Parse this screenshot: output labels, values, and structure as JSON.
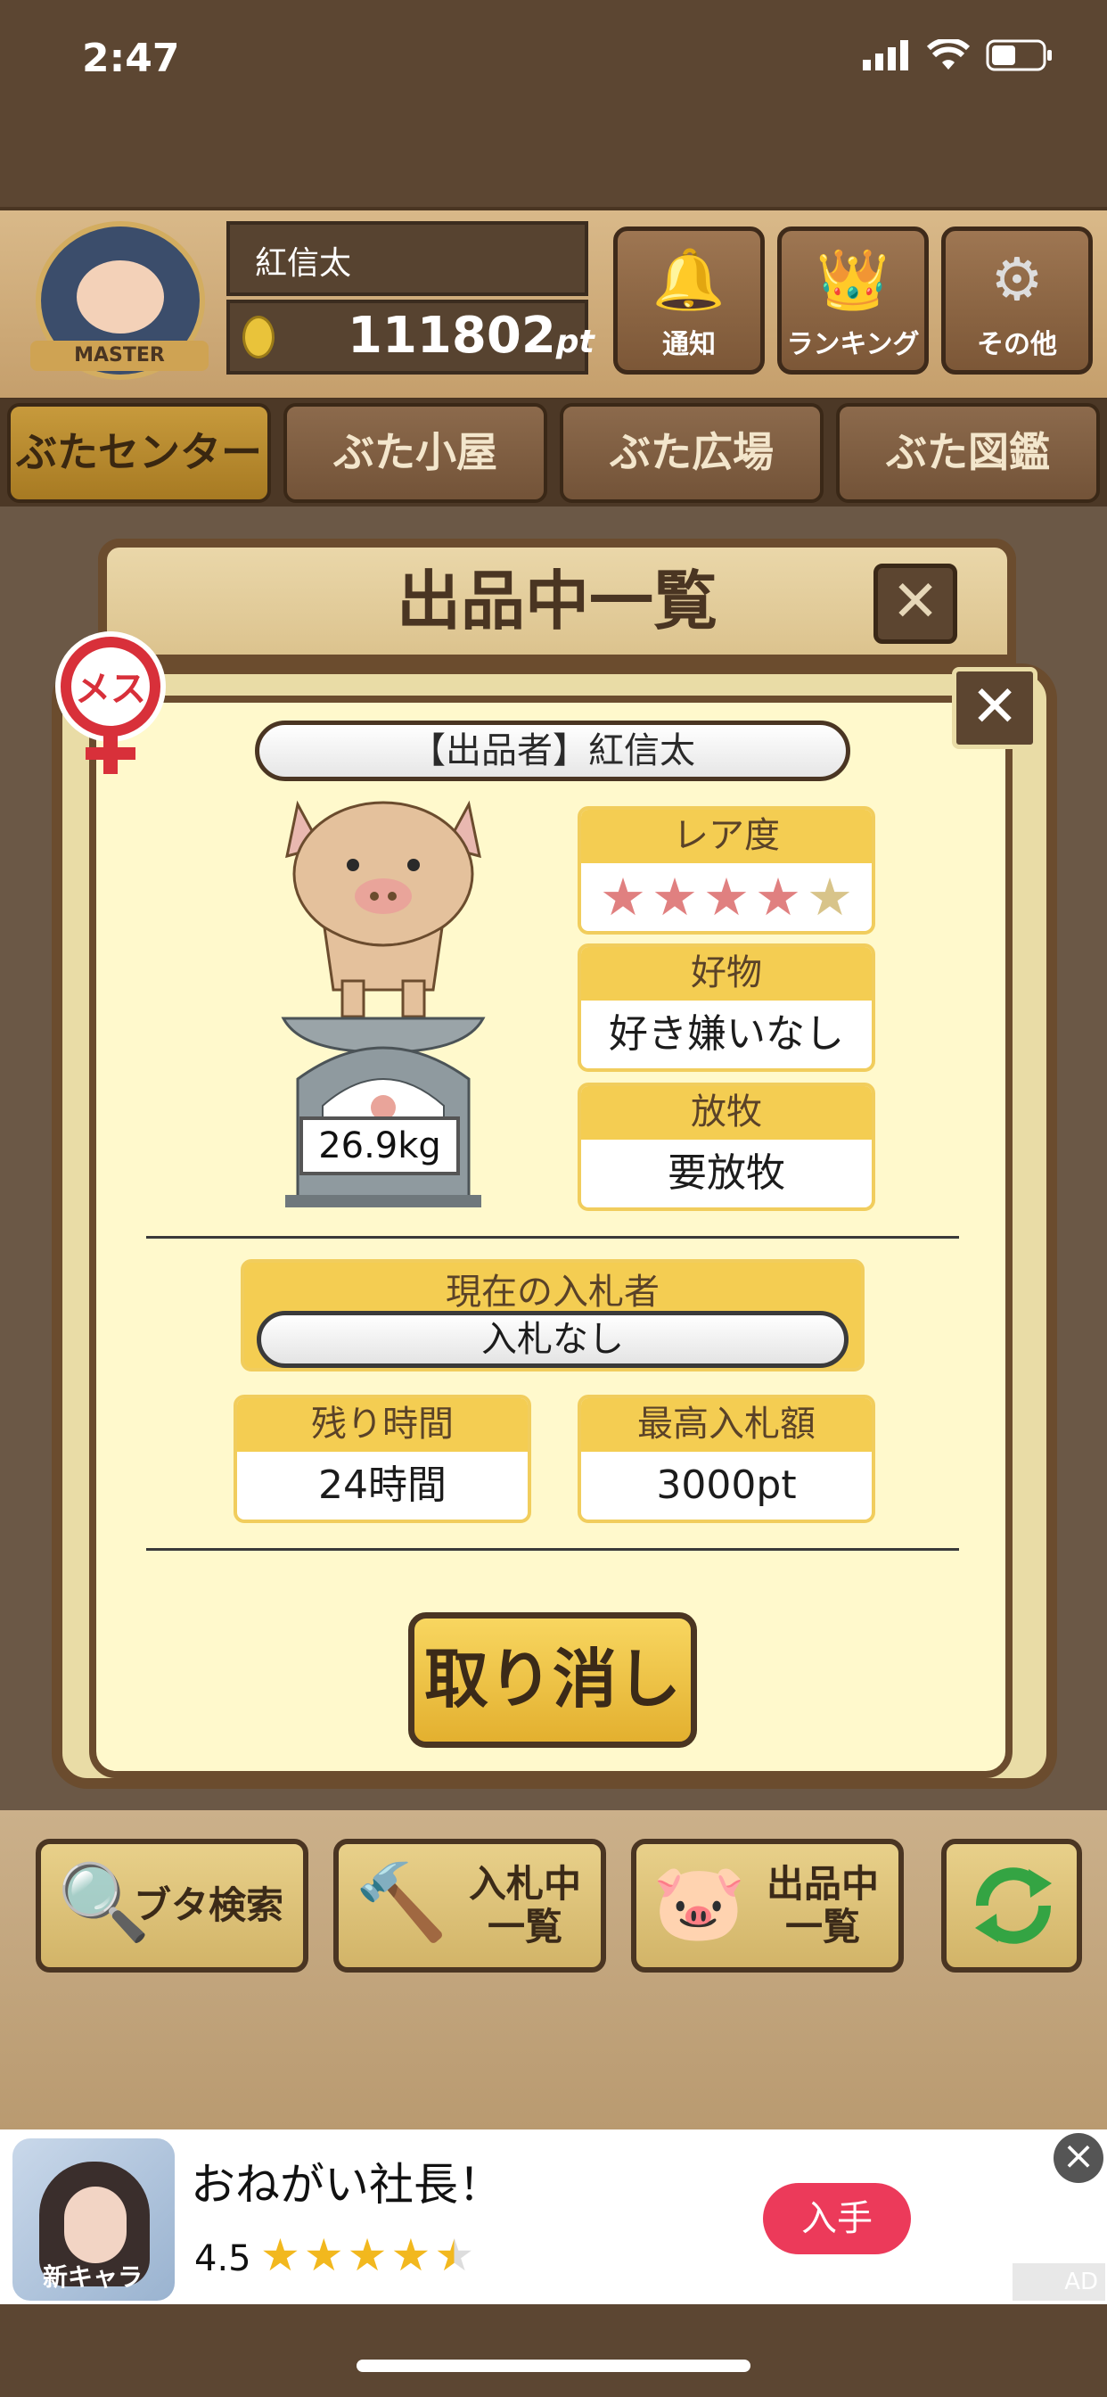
{
  "status_bar": {
    "time": "2:47"
  },
  "header": {
    "avatar_badge": "MASTER",
    "user_name": "紅信太",
    "points": "111802",
    "points_unit": "pt",
    "buttons": [
      {
        "label": "通知",
        "icon": "bell-icon"
      },
      {
        "label": "ランキング",
        "icon": "crown-icon"
      },
      {
        "label": "その他",
        "icon": "gear-icon"
      }
    ]
  },
  "tabs": [
    {
      "label": "ぶたセンター",
      "active": true
    },
    {
      "label": "ぶた小屋",
      "active": false
    },
    {
      "label": "ぶた広場",
      "active": false
    },
    {
      "label": "ぶた図鑑",
      "active": false
    }
  ],
  "listing_panel": {
    "title": "出品中一覧"
  },
  "dialog": {
    "gender_label": "メス",
    "seller_label": "【出品者】紅信太",
    "weight": "26.9kg",
    "rarity": {
      "label": "レア度",
      "rating": 4,
      "max": 5
    },
    "favorite": {
      "label": "好物",
      "value": "好き嫌いなし"
    },
    "grazing": {
      "label": "放牧",
      "value": "要放牧"
    },
    "current_bidder": {
      "label": "現在の入札者",
      "value": "入札なし"
    },
    "remaining_time": {
      "label": "残り時間",
      "value": "24時間"
    },
    "highest_bid": {
      "label": "最高入札額",
      "value": "3000pt"
    },
    "cancel_button": "取り消し"
  },
  "bottom_buttons": [
    {
      "label": "ブタ検索",
      "icon": "magnifier-icon"
    },
    {
      "label": "入札中\n一覧",
      "icon": "gavel-icon"
    },
    {
      "label": "出品中\n一覧",
      "icon": "pig-icon"
    },
    {
      "label": "",
      "icon": "refresh-icon"
    }
  ],
  "ad": {
    "image_tag": "新キャラ",
    "title": "おねがい社長！",
    "rating": "4.5",
    "get_button": "入手",
    "badge": "AD"
  },
  "colors": {
    "accent_yellow": "#f4cd52",
    "wood_dark": "#4a3522",
    "star_pink": "#e08080",
    "gender_red": "#d8303a",
    "ad_button": "#ec3a5a"
  }
}
